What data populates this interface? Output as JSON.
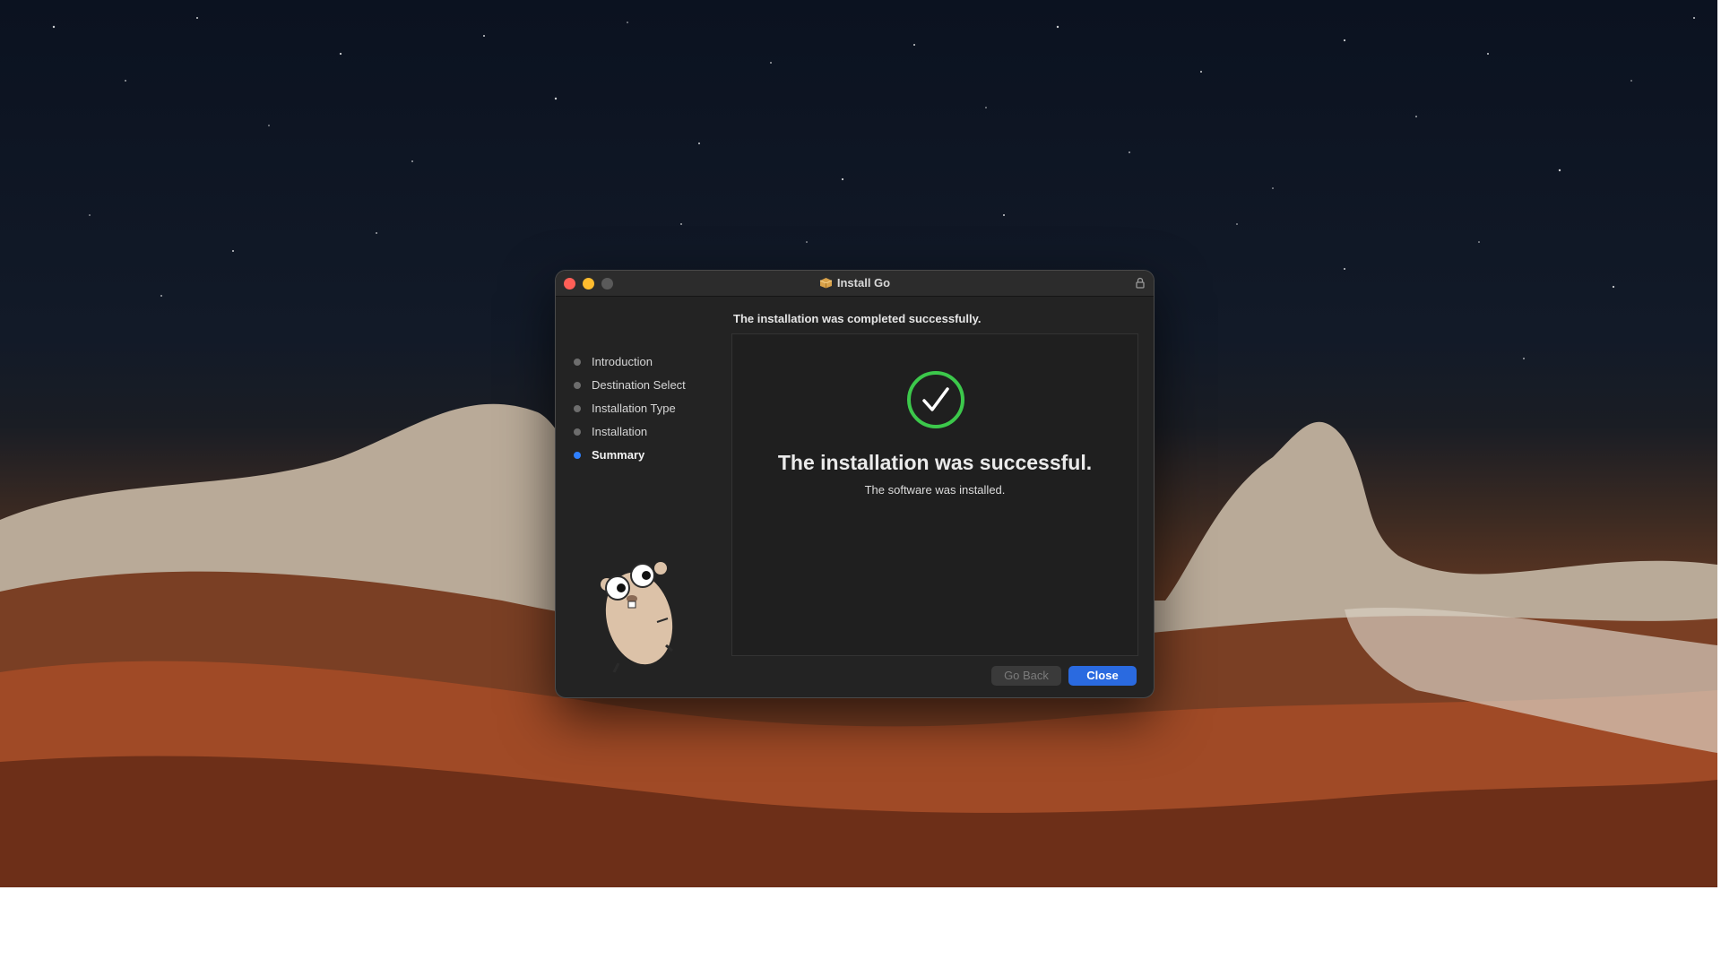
{
  "window": {
    "title": "Install Go",
    "header_message": "The installation was completed successfully."
  },
  "steps": [
    {
      "label": "Introduction",
      "active": false
    },
    {
      "label": "Destination Select",
      "active": false
    },
    {
      "label": "Installation Type",
      "active": false
    },
    {
      "label": "Installation",
      "active": false
    },
    {
      "label": "Summary",
      "active": true
    }
  ],
  "content": {
    "title": "The installation was successful.",
    "subtitle": "The software was installed."
  },
  "buttons": {
    "go_back": "Go Back",
    "close": "Close"
  },
  "colors": {
    "accent": "#2a6ae0",
    "success": "#3cc84b",
    "active_step_dot": "#2f80ff"
  },
  "icons": [
    "package-icon",
    "lock-icon",
    "checkmark-circle-icon",
    "gopher-mascot"
  ]
}
